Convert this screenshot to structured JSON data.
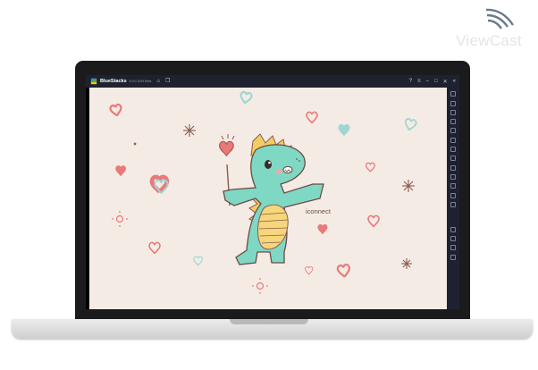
{
  "watermark": {
    "text": "ViewCast"
  },
  "emulator": {
    "app_name": "BlueStacks",
    "version": "5.9.0.1049 Beta",
    "title_icons": [
      "home-icon",
      "multi-instance-icon"
    ],
    "window_controls": [
      "help-icon",
      "menu-icon",
      "minimize-icon",
      "maximize-icon",
      "close-icon",
      "collapse-icon"
    ],
    "sidebar_icons": [
      "fullscreen-icon",
      "volume-up-icon",
      "volume-down-icon",
      "media-icon",
      "keyboard-icon",
      "rotate-icon",
      "shake-icon",
      "screenshot-icon",
      "camera-icon",
      "folder-icon",
      "copy-icon",
      "layers-icon",
      "eco-icon",
      "settings-icon",
      "back-icon",
      "home-icon",
      "recent-apps-icon"
    ]
  },
  "wallpaper": {
    "brand_text": "iconnect",
    "background_color": "#f4ebe4",
    "dino_color": "#7fd8c4",
    "belly_color": "#f6d67a",
    "spike_color": "#f3cd62",
    "heart_color": "#e97a7a"
  }
}
